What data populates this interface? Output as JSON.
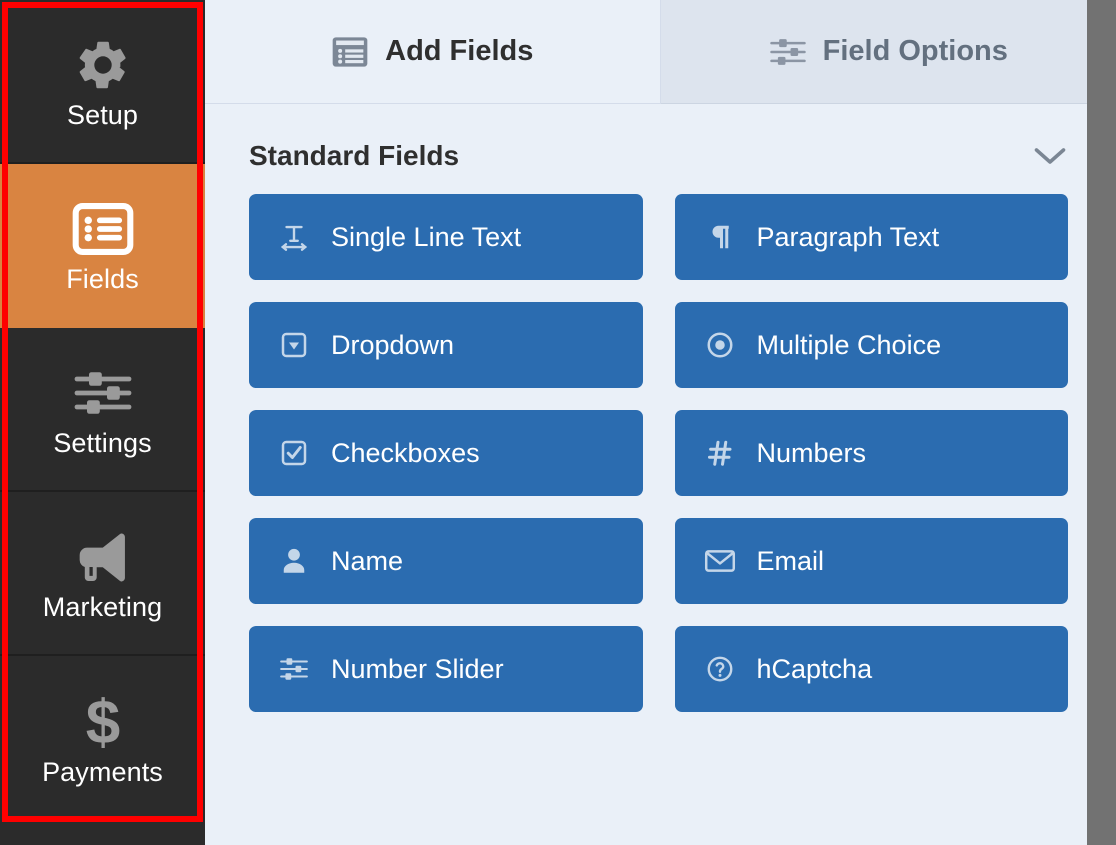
{
  "sidebar": {
    "items": [
      {
        "label": "Setup",
        "icon": "gear-icon",
        "active": false
      },
      {
        "label": "Fields",
        "icon": "list-form-icon",
        "active": true
      },
      {
        "label": "Settings",
        "icon": "sliders-icon",
        "active": false
      },
      {
        "label": "Marketing",
        "icon": "megaphone-icon",
        "active": false
      },
      {
        "label": "Payments",
        "icon": "dollar-sign-icon",
        "active": false
      }
    ]
  },
  "tabs": [
    {
      "label": "Add Fields",
      "icon": "list-form-icon",
      "active": true
    },
    {
      "label": "Field Options",
      "icon": "sliders-icon",
      "active": false
    }
  ],
  "section": {
    "title": "Standard Fields",
    "collapse_icon": "chevron-down-icon"
  },
  "fields": [
    {
      "label": "Single Line Text",
      "icon": "text-width-icon"
    },
    {
      "label": "Paragraph Text",
      "icon": "pilcrow-icon"
    },
    {
      "label": "Dropdown",
      "icon": "caret-square-down-icon"
    },
    {
      "label": "Multiple Choice",
      "icon": "radio-dot-circle-icon"
    },
    {
      "label": "Checkboxes",
      "icon": "check-square-icon"
    },
    {
      "label": "Numbers",
      "icon": "hashtag-icon"
    },
    {
      "label": "Name",
      "icon": "user-icon"
    },
    {
      "label": "Email",
      "icon": "envelope-icon"
    },
    {
      "label": "Number Slider",
      "icon": "sliders-icon"
    },
    {
      "label": "hCaptcha",
      "icon": "question-circle-icon"
    }
  ],
  "colors": {
    "sidebar_bg": "#2b2b2b",
    "sidebar_active": "#d98441",
    "panel_bg": "#eaf0f8",
    "tab_inactive_bg": "#dde4ee",
    "field_button": "#2b6cb0",
    "annotation": "#ff0000",
    "gutter": "#727272"
  },
  "annotation": {
    "shape": "rectangle",
    "target": "sidebar"
  }
}
